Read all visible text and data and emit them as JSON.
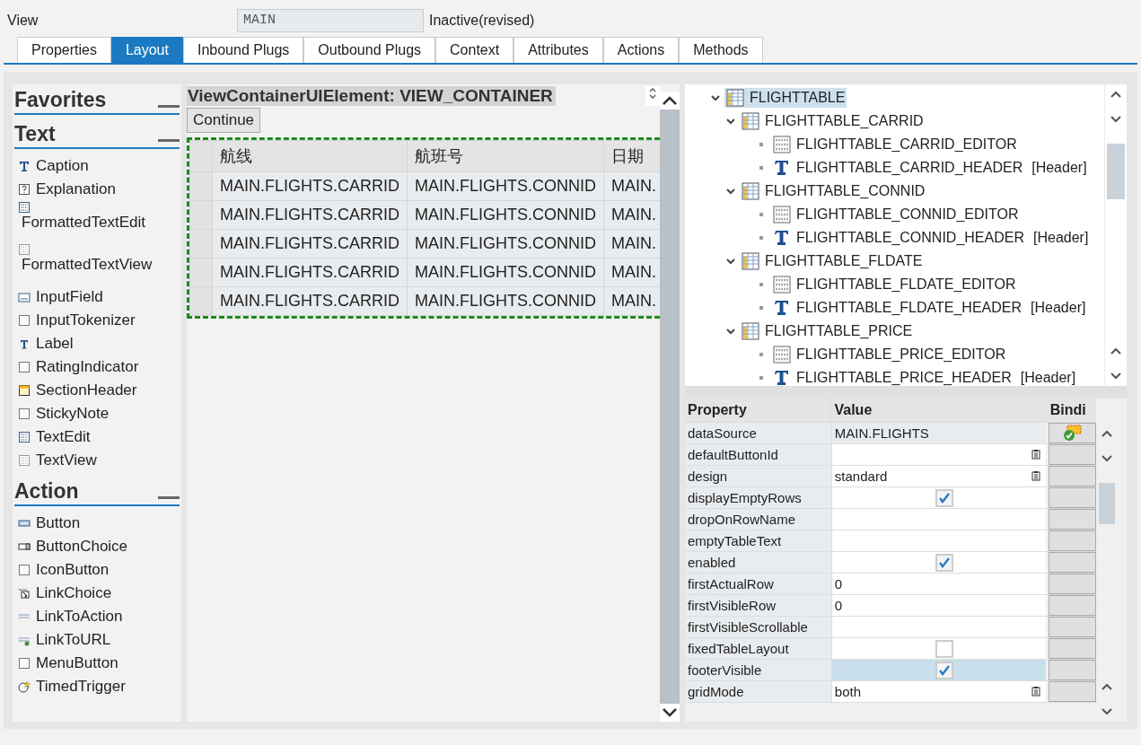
{
  "header": {
    "label": "View",
    "name": "MAIN",
    "status": "Inactive(revised)"
  },
  "tabs": [
    {
      "label": "Properties",
      "selected": false
    },
    {
      "label": "Layout",
      "selected": true
    },
    {
      "label": "Inbound Plugs",
      "selected": false
    },
    {
      "label": "Outbound Plugs",
      "selected": false
    },
    {
      "label": "Context",
      "selected": false
    },
    {
      "label": "Attributes",
      "selected": false
    },
    {
      "label": "Actions",
      "selected": false
    },
    {
      "label": "Methods",
      "selected": false
    }
  ],
  "palette": [
    {
      "title": "Favorites"
    },
    {
      "title": "Text",
      "items": [
        {
          "label": "Caption",
          "kind": "caption"
        },
        {
          "label": "Explanation",
          "kind": "explanation"
        },
        {
          "label": "FormattedTextEdit",
          "kind": "formattededit"
        },
        {
          "label": "FormattedTextView",
          "kind": "formattedview"
        },
        {
          "label": "InputField",
          "kind": "input"
        },
        {
          "label": "InputTokenizer",
          "kind": "plain"
        },
        {
          "label": "Label",
          "kind": "label"
        },
        {
          "label": "RatingIndicator",
          "kind": "plain"
        },
        {
          "label": "SectionHeader",
          "kind": "section"
        },
        {
          "label": "StickyNote",
          "kind": "plain"
        },
        {
          "label": "TextEdit",
          "kind": "textedit"
        },
        {
          "label": "TextView",
          "kind": "textview"
        }
      ]
    },
    {
      "title": "Action",
      "items": [
        {
          "label": "Button",
          "kind": "button"
        },
        {
          "label": "ButtonChoice",
          "kind": "buttonchoice"
        },
        {
          "label": "IconButton",
          "kind": "plain"
        },
        {
          "label": "LinkChoice",
          "kind": "linkchoice"
        },
        {
          "label": "LinkToAction",
          "kind": "link"
        },
        {
          "label": "LinkToURL",
          "kind": "linkurl"
        },
        {
          "label": "MenuButton",
          "kind": "plain"
        },
        {
          "label": "TimedTrigger",
          "kind": "trigger"
        }
      ]
    }
  ],
  "canvas": {
    "title": "ViewContainerUIElement: VIEW_CONTAINER",
    "button": "Continue",
    "table": {
      "columns": [
        "航线",
        "航班号",
        "日期"
      ],
      "rows": [
        [
          "MAIN.FLIGHTS.CARRID",
          "MAIN.FLIGHTS.CONNID",
          "MAIN."
        ],
        [
          "MAIN.FLIGHTS.CARRID",
          "MAIN.FLIGHTS.CONNID",
          "MAIN."
        ],
        [
          "MAIN.FLIGHTS.CARRID",
          "MAIN.FLIGHTS.CONNID",
          "MAIN."
        ],
        [
          "MAIN.FLIGHTS.CARRID",
          "MAIN.FLIGHTS.CONNID",
          "MAIN."
        ],
        [
          "MAIN.FLIGHTS.CARRID",
          "MAIN.FLIGHTS.CONNID",
          "MAIN."
        ]
      ]
    }
  },
  "tree": [
    {
      "label": "FLIGHTTABLE",
      "kind": "table",
      "expanded": true,
      "selected": true,
      "children": [
        {
          "label": "FLIGHTTABLE_CARRID",
          "kind": "table",
          "expanded": true,
          "selected": false,
          "children": [
            {
              "label": "FLIGHTTABLE_CARRID_EDITOR",
              "kind": "editor",
              "selected": false
            },
            {
              "label": "FLIGHTTABLE_CARRID_HEADER",
              "suffix": "[Header]",
              "kind": "text",
              "selected": false
            }
          ]
        },
        {
          "label": "FLIGHTTABLE_CONNID",
          "kind": "table",
          "expanded": true,
          "selected": false,
          "children": [
            {
              "label": "FLIGHTTABLE_CONNID_EDITOR",
              "kind": "editor",
              "selected": false
            },
            {
              "label": "FLIGHTTABLE_CONNID_HEADER",
              "suffix": "[Header]",
              "kind": "text",
              "selected": false
            }
          ]
        },
        {
          "label": "FLIGHTTABLE_FLDATE",
          "kind": "table",
          "expanded": true,
          "selected": false,
          "children": [
            {
              "label": "FLIGHTTABLE_FLDATE_EDITOR",
              "kind": "editor",
              "selected": false
            },
            {
              "label": "FLIGHTTABLE_FLDATE_HEADER",
              "suffix": "[Header]",
              "kind": "text",
              "selected": false
            }
          ]
        },
        {
          "label": "FLIGHTTABLE_PRICE",
          "kind": "table",
          "expanded": true,
          "selected": false,
          "children": [
            {
              "label": "FLIGHTTABLE_PRICE_EDITOR",
              "kind": "editor",
              "selected": false
            },
            {
              "label": "FLIGHTTABLE_PRICE_HEADER",
              "suffix": "[Header]",
              "kind": "text",
              "selected": false
            }
          ]
        }
      ]
    }
  ],
  "properties": {
    "columns": [
      "Property",
      "Value",
      "Bindi"
    ],
    "rows": [
      {
        "name": "dataSource",
        "kind": "text",
        "value": "MAIN.FLIGHTS",
        "bound": true,
        "selected": false
      },
      {
        "name": "defaultButtonId",
        "kind": "dropdown",
        "bound": false,
        "selected": false
      },
      {
        "name": "design",
        "kind": "dropdown",
        "value": "standard",
        "bound": false,
        "selected": false
      },
      {
        "name": "displayEmptyRows",
        "kind": "checkbox",
        "checked": true,
        "bound": false,
        "selected": false
      },
      {
        "name": "dropOnRowName",
        "kind": "text",
        "bound": false,
        "selected": false
      },
      {
        "name": "emptyTableText",
        "kind": "text",
        "bound": false,
        "selected": false
      },
      {
        "name": "enabled",
        "kind": "checkbox",
        "checked": true,
        "bound": false,
        "selected": false
      },
      {
        "name": "firstActualRow",
        "kind": "text",
        "value": "0",
        "bound": false,
        "selected": false
      },
      {
        "name": "firstVisibleRow",
        "kind": "text",
        "value": "0",
        "bound": false,
        "selected": false
      },
      {
        "name": "firstVisibleScrollable",
        "kind": "text",
        "bound": false,
        "selected": false
      },
      {
        "name": "fixedTableLayout",
        "kind": "checkbox",
        "checked": false,
        "bound": false,
        "selected": false
      },
      {
        "name": "footerVisible",
        "kind": "checkbox",
        "checked": true,
        "bound": false,
        "selected": true
      },
      {
        "name": "gridMode",
        "kind": "dropdown",
        "value": "both",
        "bound": false,
        "selected": false
      }
    ]
  }
}
